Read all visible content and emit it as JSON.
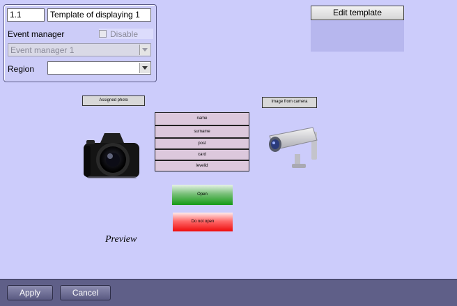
{
  "settings": {
    "id_value": "1.1",
    "name_value": "Template of displaying 1",
    "event_manager_label": "Event manager",
    "disable_label": "Disable",
    "event_manager_value": "Event manager 1",
    "region_label": "Region",
    "region_value": ""
  },
  "editor": {
    "edit_template_label": "Edit template"
  },
  "template": {
    "assigned_photo_label": "Assigned photo",
    "image_from_camera_label": "Image from camera",
    "fields": [
      "name",
      "surname",
      "post",
      "card",
      "levelid"
    ],
    "open_label": "Open",
    "do_not_open_label": "Do not open",
    "preview_label": "Preview",
    "icons": [
      "photo-camera-icon",
      "security-camera-icon"
    ]
  },
  "footer": {
    "apply_label": "Apply",
    "cancel_label": "Cancel"
  },
  "colors": {
    "background": "#ccccfb",
    "open_button": "#159a15",
    "do_not_open_button": "#ee0c0c",
    "footer_bar": "#5f5f88"
  }
}
